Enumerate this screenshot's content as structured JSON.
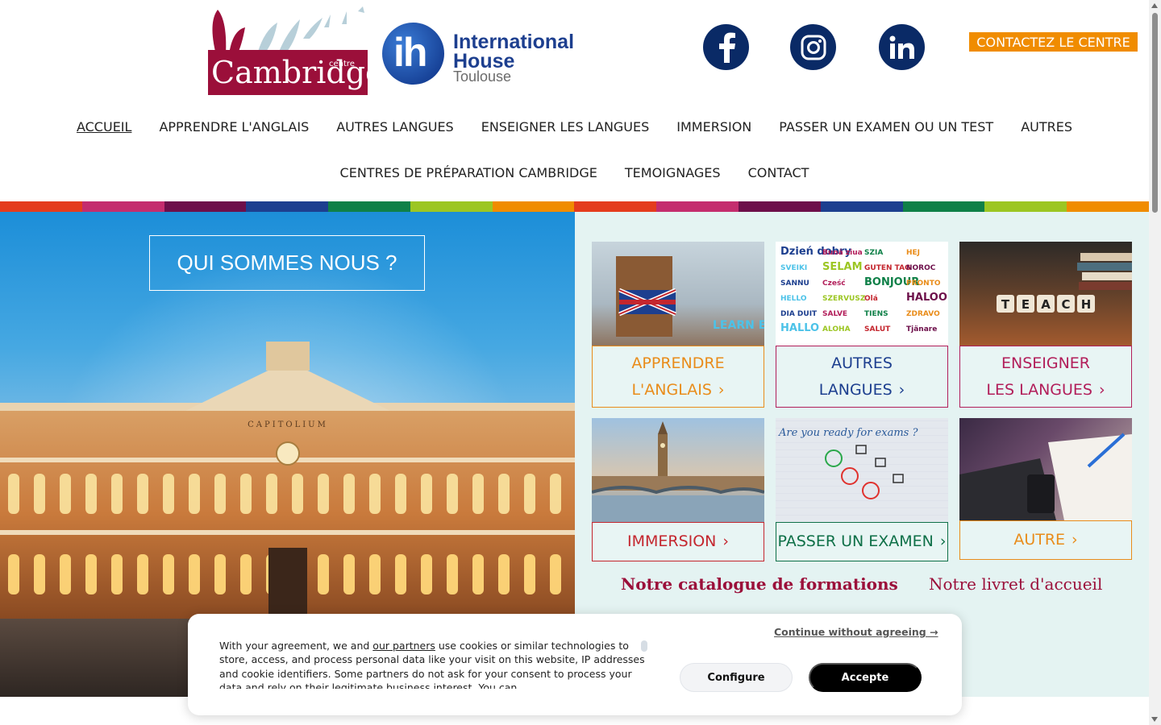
{
  "header": {
    "cambridge_logo": {
      "word": "Cambridge",
      "small": "centre"
    },
    "ih_logo": {
      "mark": "ih",
      "line1": "International",
      "line2": "House",
      "city": "Toulouse"
    },
    "social": [
      {
        "icon": "facebook-icon"
      },
      {
        "icon": "instagram-icon"
      },
      {
        "icon": "linkedin-icon"
      }
    ],
    "contact_label": "CONTACTEZ LE CENTRE"
  },
  "nav": {
    "row1": [
      "ACCUEIL",
      "APPRENDRE L'ANGLAIS",
      "AUTRES LANGUES",
      "ENSEIGNER LES LANGUES",
      "IMMERSION",
      "PASSER UN EXAMEN OU UN TEST",
      "AUTRES"
    ],
    "row2": [
      "CENTRES DE PRÉPARATION CAMBRIDGE",
      "TEMOIGNAGES",
      "CONTACT"
    ],
    "active": "ACCUEIL"
  },
  "colors": {
    "brand_red": "#9b0f3a",
    "orange": "#f08c00",
    "navy": "#0a2a66",
    "stripe": [
      "#e43c1e",
      "#c42d6e",
      "#6d0f4a",
      "#1d3f8f",
      "#0f8048",
      "#9cc623",
      "#f08c00",
      "#e43c1e",
      "#c42d6e",
      "#6d0f4a",
      "#1d3f8f",
      "#0f8048",
      "#9cc623",
      "#f08c00"
    ]
  },
  "hero": {
    "button_label": "QUI SOMMES NOUS ?",
    "building_inscription": "CAPITOLIUM"
  },
  "tiles": [
    {
      "line1": "APPRENDRE",
      "line2": "L'ANGLAIS",
      "color": "#e98c1a",
      "image_text": "LEARN ENGLISH"
    },
    {
      "line1": "AUTRES",
      "line2": "LANGUES",
      "color": "#1d3f8f"
    },
    {
      "line1": "ENSEIGNER",
      "line2": "LES LANGUES",
      "color": "#b21e5a",
      "image_text": "TEACH"
    },
    {
      "line1": "IMMERSION",
      "color": "#c4262e"
    },
    {
      "line1": "PASSER UN EXAMEN",
      "color": "#0f7048",
      "image_text": "Are you ready for exams ?"
    },
    {
      "line1": "AUTRE",
      "color": "#e98c1a"
    }
  ],
  "word_cloud": [
    "Dzień dobry",
    "Bună ziua",
    "SZIA",
    "HEJ",
    "SVEIKI",
    "SELAM",
    "GUTEN TAG",
    "NOROC",
    "SANNU",
    "Cześć",
    "BONJOUR",
    "PRONTO",
    "HELLO",
    "SZERVUSZ",
    "Olá",
    "HALOO",
    "DIA DUIT",
    "SALVE",
    "TIENS",
    "ZDRAVO",
    "HALLO",
    "ALOHA",
    "SALUT",
    "Tjänare"
  ],
  "links": {
    "catalogue": "Notre catalogue de formations",
    "livret": "Notre livret d'accueil"
  },
  "cookie": {
    "text_pre": "With your agreement, we and ",
    "partners": "our partners",
    "text_post": " use cookies or similar technologies to store, access, and process personal data like your visit on this website, IP addresses and cookie identifiers. Some partners do not ask for your consent to process your data and rely on their legitimate business interest. You can",
    "continue": "Continue without agreeing →",
    "configure": "Configure",
    "accept": "Accepte"
  }
}
